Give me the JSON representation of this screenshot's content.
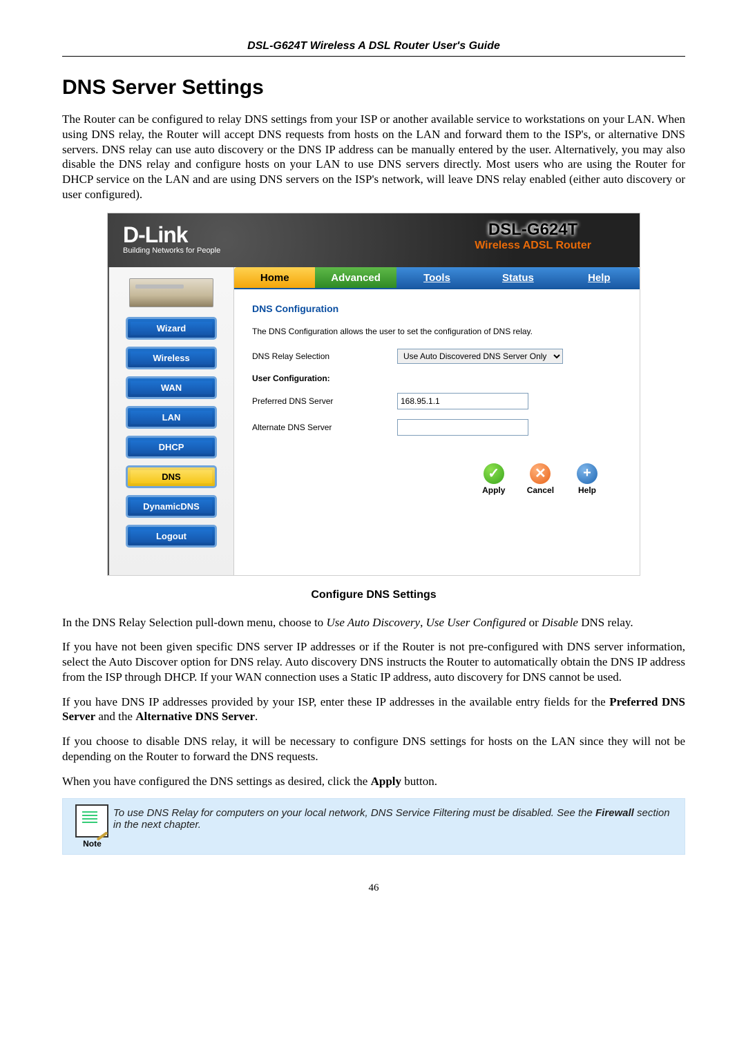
{
  "header": "DSL-G624T Wireless A DSL Router User's Guide",
  "heading": "DNS Server Settings",
  "intro": "The Router can be configured to relay DNS settings from your ISP or another available service to workstations on your LAN. When using DNS relay, the Router will accept DNS requests from hosts on the LAN and forward them to the ISP's, or alternative DNS servers. DNS relay can use auto discovery or the DNS IP address can be manually entered by the user. Alternatively, you may also disable the DNS relay and configure hosts on your LAN to use DNS servers directly. Most users who are using the Router for DHCP service on the LAN and are using DNS servers on the ISP's network, will leave DNS relay enabled (either auto discovery or user configured).",
  "shot": {
    "brand": "D-Link",
    "brand_tag": "Building Networks for People",
    "device": "DSL-G624T",
    "device_sub": "Wireless ADSL Router",
    "tabs": {
      "home": "Home",
      "advanced": "Advanced",
      "tools": "Tools",
      "status": "Status",
      "help": "Help"
    },
    "sidebar": {
      "wizard": "Wizard",
      "wireless": "Wireless",
      "wan": "WAN",
      "lan": "LAN",
      "dhcp": "DHCP",
      "dns": "DNS",
      "dynamicdns": "DynamicDNS",
      "logout": "Logout"
    },
    "panel": {
      "title": "DNS Configuration",
      "desc": "The DNS Configuration allows the user to set the configuration of DNS relay.",
      "relay_label": "DNS Relay Selection",
      "relay_value": "Use Auto Discovered DNS Server Only",
      "user_conf": "User Configuration:",
      "pref_label": "Preferred DNS Server",
      "pref_value": "168.95.1.1",
      "alt_label": "Alternate DNS Server",
      "alt_value": ""
    },
    "actions": {
      "apply": "Apply",
      "cancel": "Cancel",
      "help": "Help"
    }
  },
  "caption": "Configure DNS Settings",
  "p1_a": "In the DNS Relay Selection pull-down menu, choose to ",
  "p1_i1": "Use Auto Discovery",
  "p1_b": ", ",
  "p1_i2": "Use User Configured",
  "p1_c": " or ",
  "p1_i3": "Disable",
  "p1_d": " DNS relay.",
  "p2": "If you have not been given specific DNS server IP addresses or if the Router is not pre-configured with DNS server information, select the Auto Discover option for DNS relay. Auto discovery DNS instructs the Router to automatically obtain the DNS IP address from the ISP through DHCP. If your WAN connection uses a Static IP address, auto discovery for DNS cannot be used.",
  "p3_a": "If you have DNS IP addresses provided by your ISP, enter these IP addresses in the available entry fields for the ",
  "p3_b1": "Preferred DNS Server",
  "p3_b": " and the ",
  "p3_b2": "Alternative DNS Server",
  "p3_c": ".",
  "p4": "If you choose to disable DNS relay, it will be necessary to configure DNS settings for hosts on the LAN since they will not be depending on the Router to forward the DNS requests.",
  "p5_a": "When you have configured the DNS settings as desired, click the ",
  "p5_b": "Apply",
  "p5_c": " button.",
  "note": {
    "label": "Note",
    "text_a": "To use DNS Relay for computers on your local network, DNS Service Filtering must be disabled. See the ",
    "text_b": "Firewall",
    "text_c": " section in the next chapter."
  },
  "pagenum": "46"
}
